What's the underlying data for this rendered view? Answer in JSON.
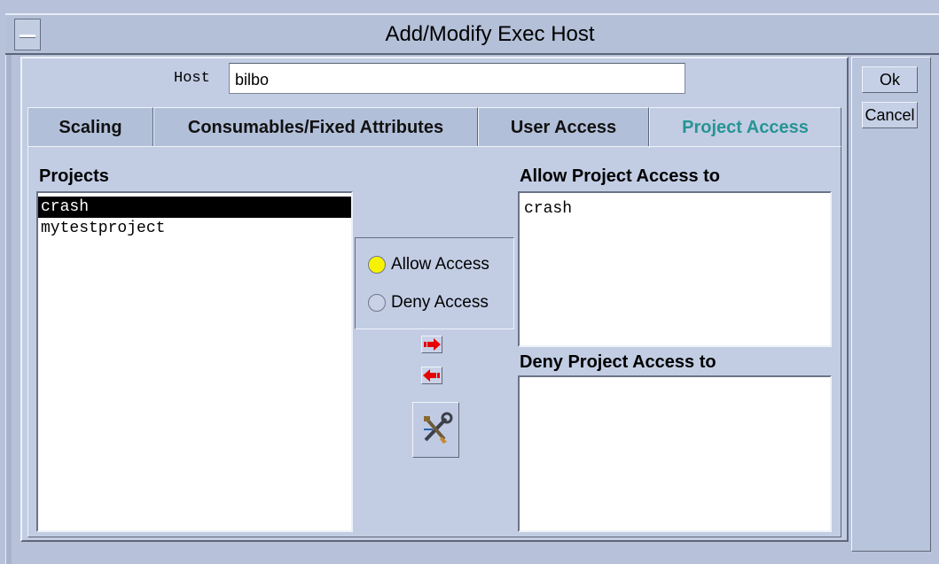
{
  "window": {
    "title": "Add/Modify Exec Host"
  },
  "host": {
    "label": "Host",
    "value": "bilbo"
  },
  "tabs": [
    {
      "label": "Scaling"
    },
    {
      "label": "Consumables/Fixed Attributes"
    },
    {
      "label": "User Access"
    },
    {
      "label": "Project Access",
      "active": true
    }
  ],
  "projects": {
    "title": "Projects",
    "items": [
      "crash",
      "mytestproject"
    ],
    "selected": "crash"
  },
  "access": {
    "allow_label": "Allow Access",
    "deny_label": "Deny Access",
    "selected": "Allow Access"
  },
  "allow_list": {
    "title": "Allow Project Access to",
    "items": [
      "crash"
    ]
  },
  "deny_list": {
    "title": "Deny Project Access to",
    "items": []
  },
  "buttons": {
    "ok": "Ok",
    "cancel": "Cancel"
  },
  "icons": {
    "menu": "window-menu-icon",
    "add": "arrow-right-icon",
    "remove": "arrow-left-icon",
    "tool": "wrench-tool-icon"
  },
  "colors": {
    "active_tab_text": "#279494",
    "selection_bg": "#000000",
    "radio_on": "#f7f300",
    "arrow": "#e60000",
    "panel": "#c2cde4"
  }
}
